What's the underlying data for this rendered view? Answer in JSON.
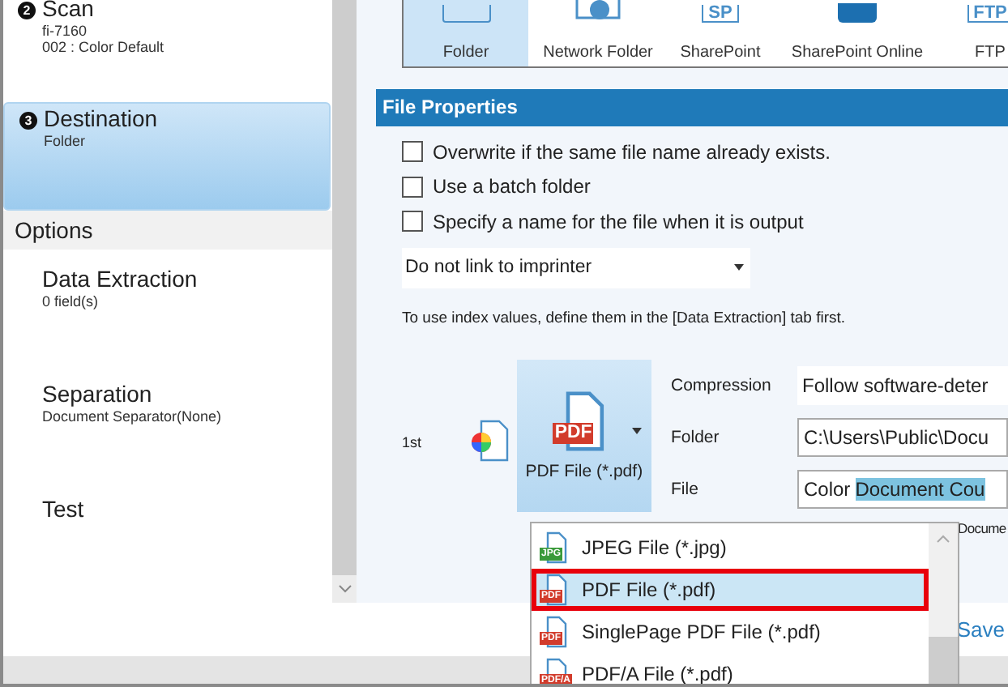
{
  "sidebar": {
    "steps": [
      {
        "step": "2",
        "title": "Scan",
        "details": [
          "fi-7160",
          "002 : Color Default"
        ],
        "selected": false
      },
      {
        "step": "3",
        "title": "Destination",
        "details": [
          "Folder"
        ],
        "selected": true
      }
    ],
    "options_header": "Options",
    "options": [
      {
        "title": "Data Extraction",
        "details": [
          "0 field(s)"
        ]
      },
      {
        "title": "Separation",
        "details": [
          "Document Separator(None)"
        ]
      },
      {
        "title": "Test"
      }
    ]
  },
  "destinations": [
    {
      "label": "Folder",
      "kind": "folder",
      "selected": true
    },
    {
      "label": "Network Folder",
      "kind": "network",
      "selected": false
    },
    {
      "label": "SharePoint",
      "kind": "sp",
      "icon_text": "SP",
      "selected": false
    },
    {
      "label": "SharePoint Online",
      "kind": "spo",
      "selected": false
    },
    {
      "label": "FTP",
      "kind": "ftp",
      "icon_text": "FTP",
      "selected": false
    }
  ],
  "file_properties": {
    "title": "File Properties",
    "checkboxes": [
      {
        "label": "Overwrite if the same file name already exists.",
        "checked": false
      },
      {
        "label": "Use a batch folder",
        "checked": false
      },
      {
        "label": "Specify a name for the file when it is output",
        "checked": false
      }
    ],
    "imprinter": {
      "value": "Do not link to imprinter"
    },
    "note": "To use index values, define them in the [Data Extraction] tab first."
  },
  "output": {
    "order": "1st",
    "format_button": {
      "label": "PDF File (*.pdf)",
      "icon_text": "PDF"
    },
    "fields": [
      {
        "label": "Compression",
        "value": "Follow software-deter"
      },
      {
        "label": "Folder",
        "value": "C:\\Users\\Public\\Docu"
      },
      {
        "label": "File",
        "value": "Color",
        "token": "Document Cou"
      }
    ],
    "partial_text": "Docume"
  },
  "format_menu": {
    "items": [
      {
        "label": "JPEG File (*.jpg)",
        "kind": "jpg",
        "icon_text": "JPG",
        "selected": false
      },
      {
        "label": "PDF File (*.pdf)",
        "kind": "pdf",
        "icon_text": "PDF",
        "selected": true
      },
      {
        "label": "SinglePage PDF File (*.pdf)",
        "kind": "pdf",
        "icon_text": "PDF",
        "selected": false
      },
      {
        "label": "PDF/A File (*.pdf)",
        "kind": "pdfa",
        "icon_text": "PDF/A",
        "selected": false
      }
    ]
  },
  "save_button": {
    "label": "Save"
  }
}
